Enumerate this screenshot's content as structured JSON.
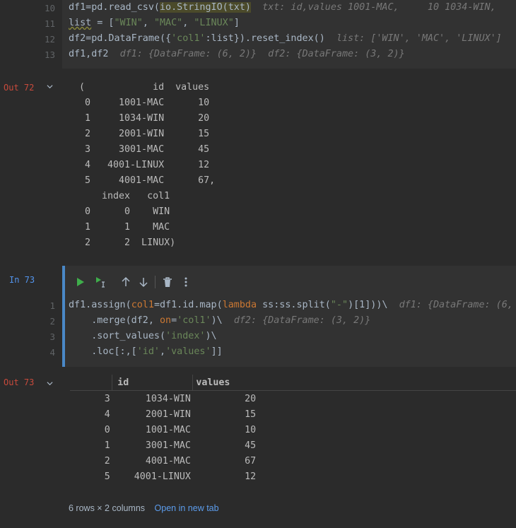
{
  "cell_in_top": {
    "lines": [
      {
        "n": "10",
        "segments": [
          {
            "t": "df1=pd.read_csv(",
            "c": ""
          },
          {
            "t": "io.StringIO(txt)",
            "c": "hl"
          },
          {
            "t": "  ",
            "c": ""
          },
          {
            "t": "txt: id,values 1001-MAC,     10 1034-WIN,",
            "c": "hint"
          }
        ]
      },
      {
        "n": "11",
        "segments": [
          {
            "t": "list",
            "c": "wave"
          },
          {
            "t": " = [",
            "c": ""
          },
          {
            "t": "\"WIN\"",
            "c": "str"
          },
          {
            "t": ", ",
            "c": ""
          },
          {
            "t": "\"MAC\"",
            "c": "str"
          },
          {
            "t": ", ",
            "c": ""
          },
          {
            "t": "\"LINUX\"",
            "c": "str"
          },
          {
            "t": "]",
            "c": ""
          }
        ]
      },
      {
        "n": "12",
        "segments": [
          {
            "t": "df2=pd.DataFrame({",
            "c": ""
          },
          {
            "t": "'col1'",
            "c": "str"
          },
          {
            "t": ":list}).reset_index()  ",
            "c": ""
          },
          {
            "t": "list: ['WIN', 'MAC', 'LINUX']",
            "c": "hint"
          }
        ]
      },
      {
        "n": "13",
        "segments": [
          {
            "t": "df1,df2  ",
            "c": ""
          },
          {
            "t": "df1: {DataFrame: (6, 2)}  df2: {DataFrame: (3, 2)}",
            "c": "hint"
          }
        ]
      }
    ]
  },
  "out72": {
    "label": "Out 72",
    "text_lines": [
      "(            id  values",
      " 0     1001-MAC      10",
      " 1     1034-WIN      20",
      " 2     2001-WIN      15",
      " 3     3001-MAC      45",
      " 4   4001-LINUX      12",
      " 5     4001-MAC      67,",
      "    index   col1",
      " 0      0    WIN",
      " 1      1    MAC",
      " 2      2  LINUX)"
    ]
  },
  "in73": {
    "label": "In 73",
    "lines": [
      {
        "n": "1",
        "segments": [
          {
            "t": "df1.assign(",
            "c": ""
          },
          {
            "t": "col1",
            "c": "kw"
          },
          {
            "t": "=df1.id.map(",
            "c": ""
          },
          {
            "t": "lambda",
            "c": "kw"
          },
          {
            "t": " ss:ss.split(",
            "c": ""
          },
          {
            "t": "\"-\"",
            "c": "str"
          },
          {
            "t": ")[1]))\\  ",
            "c": ""
          },
          {
            "t": "df1: {DataFrame: (6, 2)}",
            "c": "hint"
          }
        ]
      },
      {
        "n": "2",
        "segments": [
          {
            "t": "    .merge(df2, ",
            "c": ""
          },
          {
            "t": "on",
            "c": "kw"
          },
          {
            "t": "=",
            "c": ""
          },
          {
            "t": "'col1'",
            "c": "str"
          },
          {
            "t": ")\\  ",
            "c": ""
          },
          {
            "t": "df2: {DataFrame: (3, 2)}",
            "c": "hint"
          }
        ]
      },
      {
        "n": "3",
        "segments": [
          {
            "t": "    .sort_values(",
            "c": ""
          },
          {
            "t": "'index'",
            "c": "str"
          },
          {
            "t": ")\\",
            "c": ""
          }
        ]
      },
      {
        "n": "4",
        "segments": [
          {
            "t": "    .loc[:,[",
            "c": ""
          },
          {
            "t": "'id'",
            "c": "str"
          },
          {
            "t": ",",
            "c": ""
          },
          {
            "t": "'values'",
            "c": "str"
          },
          {
            "t": "]]",
            "c": ""
          }
        ]
      }
    ]
  },
  "out73": {
    "label": "Out 73",
    "columns": [
      "id",
      "values"
    ],
    "rows": [
      {
        "index": "3",
        "id": "1034-WIN",
        "values": "20"
      },
      {
        "index": "4",
        "id": "2001-WIN",
        "values": "15"
      },
      {
        "index": "0",
        "id": "1001-MAC",
        "values": "10"
      },
      {
        "index": "1",
        "id": "3001-MAC",
        "values": "45"
      },
      {
        "index": "2",
        "id": "4001-MAC",
        "values": "67"
      },
      {
        "index": "5",
        "id": "4001-LINUX",
        "values": "12"
      }
    ],
    "summary": "6 rows × 2 columns",
    "open_link": "Open in new tab"
  },
  "colors": {
    "run": "#3fae4b",
    "accent": "#4a88c7",
    "out_label": "#c84a3c",
    "in_label": "#5394ec"
  }
}
